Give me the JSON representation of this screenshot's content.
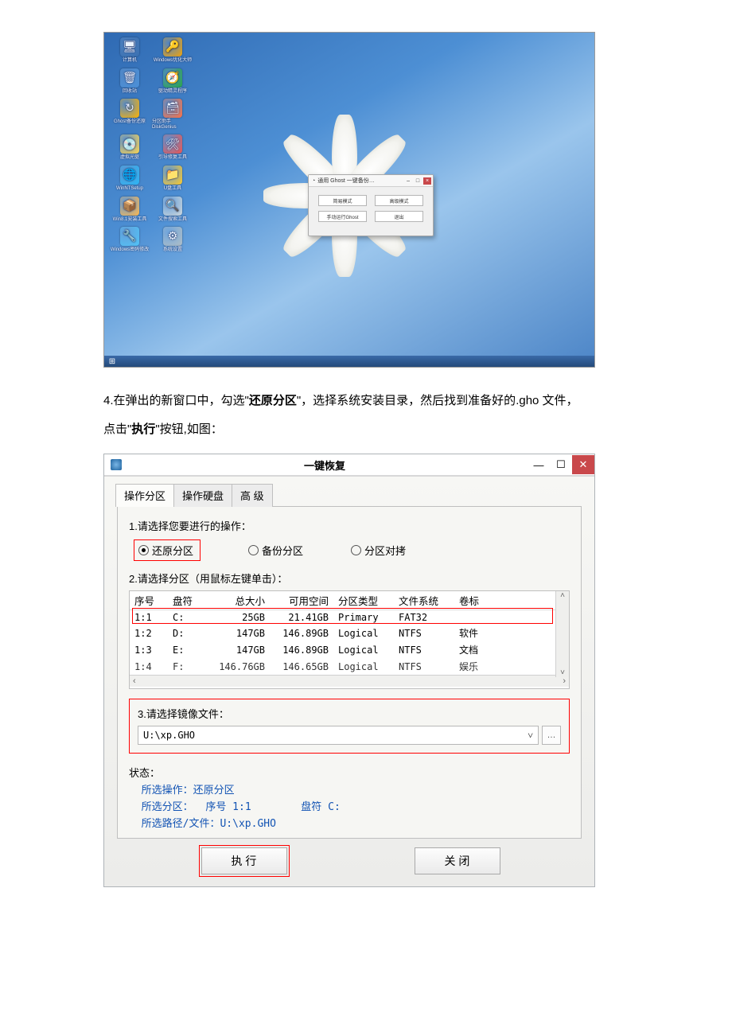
{
  "desktop": {
    "icons": [
      {
        "label": "计算机",
        "glyph": "🖥",
        "bg": "#3a6fb0"
      },
      {
        "label": "Windows优化大师",
        "glyph": "🔑",
        "bg": "#f0a30a"
      },
      {
        "label": "回收站",
        "glyph": "🗑",
        "bg": "#4a90d9"
      },
      {
        "label": "驱动精灵程序",
        "glyph": "🧭",
        "bg": "#28a745"
      },
      {
        "label": "Ghost备份还原",
        "glyph": "↻",
        "bg": "#ffb300"
      },
      {
        "label": "分区助手 DiskGenius",
        "glyph": "🗃",
        "bg": "#ff7043"
      },
      {
        "label": "虚拟光驱",
        "glyph": "💿",
        "bg": "#ffd54f"
      },
      {
        "label": "引导修复工具",
        "glyph": "🛠",
        "bg": "#ef5350"
      },
      {
        "label": "WinNTSetup",
        "glyph": "🌐",
        "bg": "#29b6f6"
      },
      {
        "label": "U盘工具",
        "glyph": "📁",
        "bg": "#ffca28"
      },
      {
        "label": "Win8.1安装工具",
        "glyph": "📦",
        "bg": "#ffb74d"
      },
      {
        "label": "文件搜索工具",
        "glyph": "🔍",
        "bg": "#cfd8dc"
      },
      {
        "label": "Windows密码修改",
        "glyph": "🔧",
        "bg": "#4fc3f7"
      },
      {
        "label": "系统设置",
        "glyph": "⚙",
        "bg": "#b0bec5"
      }
    ],
    "dialog": {
      "title": "通用 Ghost 一键备份…",
      "buttons": [
        "简易模式",
        "高级模式",
        "手动运行Ghost",
        "退出"
      ]
    }
  },
  "instruction": {
    "prefix": "4.",
    "t1": "在弹出的新窗口中，勾选\"",
    "b1": "还原分区",
    "t2": "\"，选择系统安装目录，然后找到准备好的",
    "b2": ".gho 文件",
    "prefix2": "点击\"",
    "b3": "执行",
    "t3": "\"按钮,如图："
  },
  "tool": {
    "title": "一键恢复",
    "tabs": {
      "partition": "操作分区",
      "disk": "操作硬盘",
      "advanced": "高 级"
    },
    "step1": {
      "label": "1.请选择您要进行的操作：",
      "opt_restore": "还原分区",
      "opt_backup": "备份分区",
      "opt_clone": "分区对拷"
    },
    "step2": {
      "label": "2.请选择分区（用鼠标左键单击）：",
      "headers": {
        "idx": "序号",
        "drive": "盘符",
        "total": "总大小",
        "free": "可用空间",
        "ptype": "分区类型",
        "fs": "文件系统",
        "vol": "卷标"
      },
      "rows": [
        {
          "idx": "1:1",
          "drive": "C:",
          "total": "25GB",
          "free": "21.41GB",
          "ptype": "Primary",
          "fs": "FAT32",
          "vol": ""
        },
        {
          "idx": "1:2",
          "drive": "D:",
          "total": "147GB",
          "free": "146.89GB",
          "ptype": "Logical",
          "fs": "NTFS",
          "vol": "软件"
        },
        {
          "idx": "1:3",
          "drive": "E:",
          "total": "147GB",
          "free": "146.89GB",
          "ptype": "Logical",
          "fs": "NTFS",
          "vol": "文档"
        },
        {
          "idx": "1:4",
          "drive": "F:",
          "total": "146.76GB",
          "free": "146.65GB",
          "ptype": "Logical",
          "fs": "NTFS",
          "vol": "娱乐"
        }
      ]
    },
    "step3": {
      "label": "3.请选择镜像文件：",
      "path": "U:\\xp.GHO"
    },
    "status": {
      "label": "状态：",
      "op_label": "所选操作：",
      "op_value": "还原分区",
      "part_label": "所选分区：",
      "part_idx_label": "序号",
      "part_idx": "1:1",
      "part_drive_label": "盘符",
      "part_drive": "C:",
      "file_label": "所选路径/文件：",
      "file_value": "U:\\xp.GHO"
    },
    "buttons": {
      "run": "执 行",
      "close": "关 闭"
    }
  }
}
